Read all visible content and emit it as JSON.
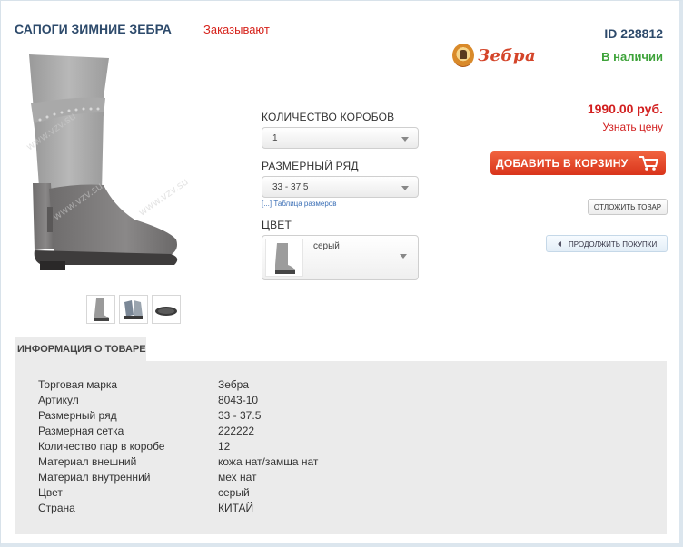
{
  "product": {
    "title": "САПОГИ ЗИМНИЕ ЗЕБРА",
    "status_ordered": "Заказывают",
    "id_text": "ID 228812",
    "brand_logo_text": "Зебра",
    "availability": "В наличии"
  },
  "options": {
    "boxes_label": "КОЛИЧЕСТВО КОРОБОВ",
    "boxes_value": "1",
    "size_label": "РАЗМЕРНЫЙ РЯД",
    "size_value": "33 - 37.5",
    "size_table_link": "[...] Таблица размеров",
    "color_label": "ЦВЕТ",
    "color_value": "серый"
  },
  "pricing": {
    "price": "1990.00 руб.",
    "price_link": "Узнать цену",
    "add_to_cart": "ДОБАВИТЬ В КОРЗИНУ",
    "defer": "ОТЛОЖИТЬ ТОВАР",
    "continue": "ПРОДОЛЖИТЬ ПОКУПКИ"
  },
  "info": {
    "tab_label": "ИНФОРМАЦИЯ О ТОВАРЕ",
    "rows": [
      {
        "label": "Торговая марка",
        "value": "Зебра"
      },
      {
        "label": "Артикул",
        "value": "8043-10"
      },
      {
        "label": "Размерный ряд",
        "value": "33 - 37.5"
      },
      {
        "label": "Размерная сетка",
        "value": "222222"
      },
      {
        "label": "Количество пар в коробе",
        "value": "12"
      },
      {
        "label": "Материал внешний",
        "value": "кожа нат/замша нат"
      },
      {
        "label": "Материал внутренний",
        "value": "мех нат"
      },
      {
        "label": "Цвет",
        "value": "серый"
      },
      {
        "label": "Страна",
        "value": "КИТАЙ"
      }
    ]
  },
  "colors": {
    "title": "#2d4a6b",
    "price_red": "#d21f1f",
    "in_stock_green": "#3ea33a",
    "cart_button": "#e04a2a",
    "panel_bg": "#ebebeb"
  }
}
